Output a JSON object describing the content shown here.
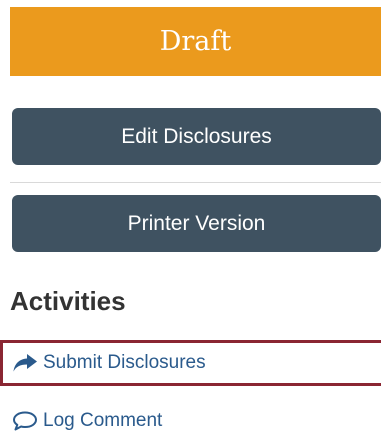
{
  "status": {
    "label": "Draft",
    "color": "#eb9a1d"
  },
  "buttons": {
    "edit_label": "Edit Disclosures",
    "print_label": "Printer Version",
    "color": "#3f5261"
  },
  "activities": {
    "title": "Activities",
    "items": [
      {
        "label": "Submit Disclosures",
        "icon": "share-arrow-icon",
        "highlighted": true
      },
      {
        "label": "Log Comment",
        "icon": "speech-bubble-icon",
        "highlighted": false
      }
    ],
    "link_color": "#2a5a8c",
    "highlight_color": "#8a2632"
  }
}
